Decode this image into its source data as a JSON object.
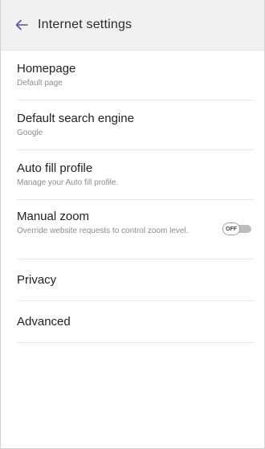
{
  "header": {
    "title": "Internet settings",
    "back_icon": "back-arrow-icon",
    "accent_color": "#5e4fa2"
  },
  "items": [
    {
      "title": "Homepage",
      "subtitle": "Default page"
    },
    {
      "title": "Default search engine",
      "subtitle": "Google"
    },
    {
      "title": "Auto fill profile",
      "subtitle": "Manage your Auto fill profile."
    },
    {
      "title": "Manual zoom",
      "subtitle": "Override website requests to control zoom level.",
      "toggle_label": "OFF",
      "toggle_on": false
    },
    {
      "title": "Privacy"
    },
    {
      "title": "Advanced"
    }
  ]
}
